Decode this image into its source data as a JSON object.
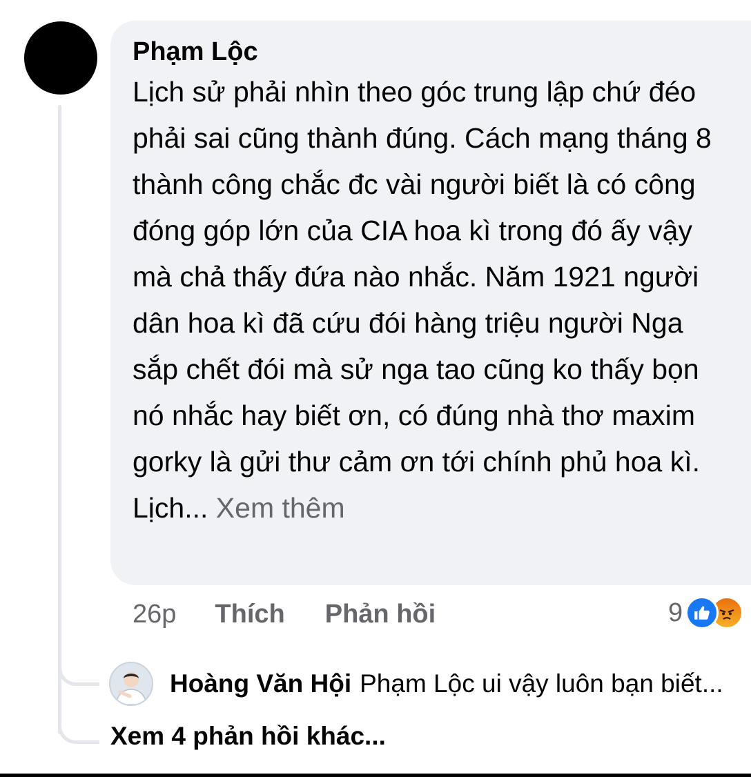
{
  "comment": {
    "author": "Phạm Lộc",
    "text": "Lịch sử phải nhìn theo góc trung lập chứ đéo phải sai cũng thành đúng. Cách mạng tháng 8 thành công chắc đc vài người biết là có công đóng góp lớn của CIA hoa kì trong đó ấy vậy mà chả thấy đứa nào nhắc. Năm 1921 người dân hoa kì đã cứu đói hàng triệu người Nga sắp chết đói mà sử nga tao cũng ko thấy bọn nó nhắc hay biết ơn, có đúng nhà thơ maxim gorky là gửi thư cảm ơn tới chính phủ hoa kì. Lịch...",
    "see_more": "Xem thêm",
    "time": "26p",
    "like_label": "Thích",
    "reply_label": "Phản hồi",
    "reaction_count": "9",
    "reaction_icons": [
      "like-icon",
      "angry-icon"
    ],
    "avatar_color": "#000000"
  },
  "reply": {
    "author": "Hoàng Văn Hội",
    "text": "Phạm Lộc ui vậy luôn bạn biết..."
  },
  "more_replies_label": "Xem 4 phản hồi khác...",
  "colors": {
    "bubble": "#f0f2f5",
    "secondary_text": "#65676b",
    "like_blue": "#1877f2",
    "thread_line": "#e4e6eb"
  }
}
